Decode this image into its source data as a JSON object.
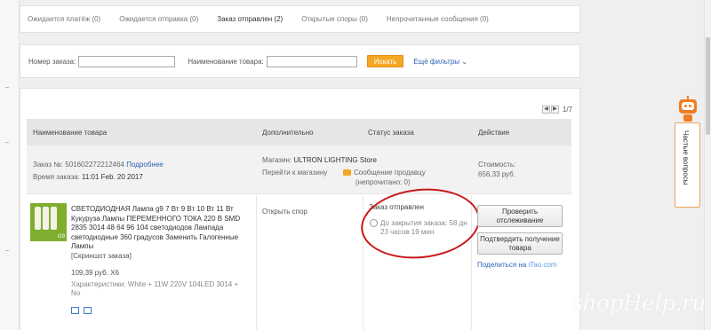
{
  "tabs": [
    {
      "label": "Ожидается платёж (0)"
    },
    {
      "label": "Ожидается отправка (0)"
    },
    {
      "label": "Заказ отправлен (2)"
    },
    {
      "label": "Открытые споры (0)"
    },
    {
      "label": "Непрочитанные сообщения (0)"
    }
  ],
  "active_tab_index": 2,
  "filters": {
    "order_number_label": "Номер заказа:",
    "order_number_value": "",
    "product_name_label": "Наименование товара:",
    "product_name_value": "",
    "search_button": "Искать",
    "more_filters": "Ещё фильтры"
  },
  "pager": {
    "prev": "◀",
    "next": "▶",
    "page_text": "1/7"
  },
  "table_headers": {
    "product": "Наименование товара",
    "extra": "Дополнительно",
    "status": "Статус заказа",
    "action": "Действие"
  },
  "order": {
    "order_no_label": "Заказ №:",
    "order_no": "501602272212464",
    "details_link": "Подробнее",
    "order_time_label": "Время заказа:",
    "order_time": "11:01 Feb. 20 2017",
    "store_label": "Магазин:",
    "store_name": "ULTRON LIGHTING Store",
    "go_to_store": "Перейти к магазину",
    "message_seller": "Сообщение продавцу",
    "unread": "(непрочитано: 0)",
    "cost_label": "Стоимость:",
    "cost": "656,33 руб."
  },
  "item": {
    "title": "СВЕТОДИОДНАЯ Лампа g9 7 Вт 9 Вт 10 Вт 11 Вт Кукуруза Лампы ПЕРЕМЕННОГО ТОКА 220 В SMD 2835 3014 48 64 96 104 светодиодов Лампада светодиодные 360 градусов Заменить Галогенные Лампы",
    "snapshot": "[Скриншот заказа]",
    "price_qty": "109,39 руб. X6",
    "characteristics": "Характеристики: White + 11W 220V 104LED 3014 + No",
    "thumb_badge": "G9",
    "open_dispute": "Открыть спор",
    "status": "Заказ отправлен",
    "countdown": "До закрытия заказа: 58 дн 23 часов 19 мин",
    "btn_track": "Проверить отслеживание",
    "btn_confirm": "Подтвердить получение товара",
    "share_prefix": "Поделиться на",
    "share_site": "iTao.com"
  },
  "side_tab": {
    "label": "Частые вопросы"
  },
  "watermark": "shopHelp.ru",
  "colors": {
    "accent": "#f5a623",
    "link": "#2a62b5",
    "price": "#e64c1c",
    "annotation": "#c81919"
  },
  "icons": [
    "chevron-down-icon",
    "mail-icon",
    "clock-icon",
    "shipping-icon",
    "box-icon",
    "robot-icon"
  ]
}
